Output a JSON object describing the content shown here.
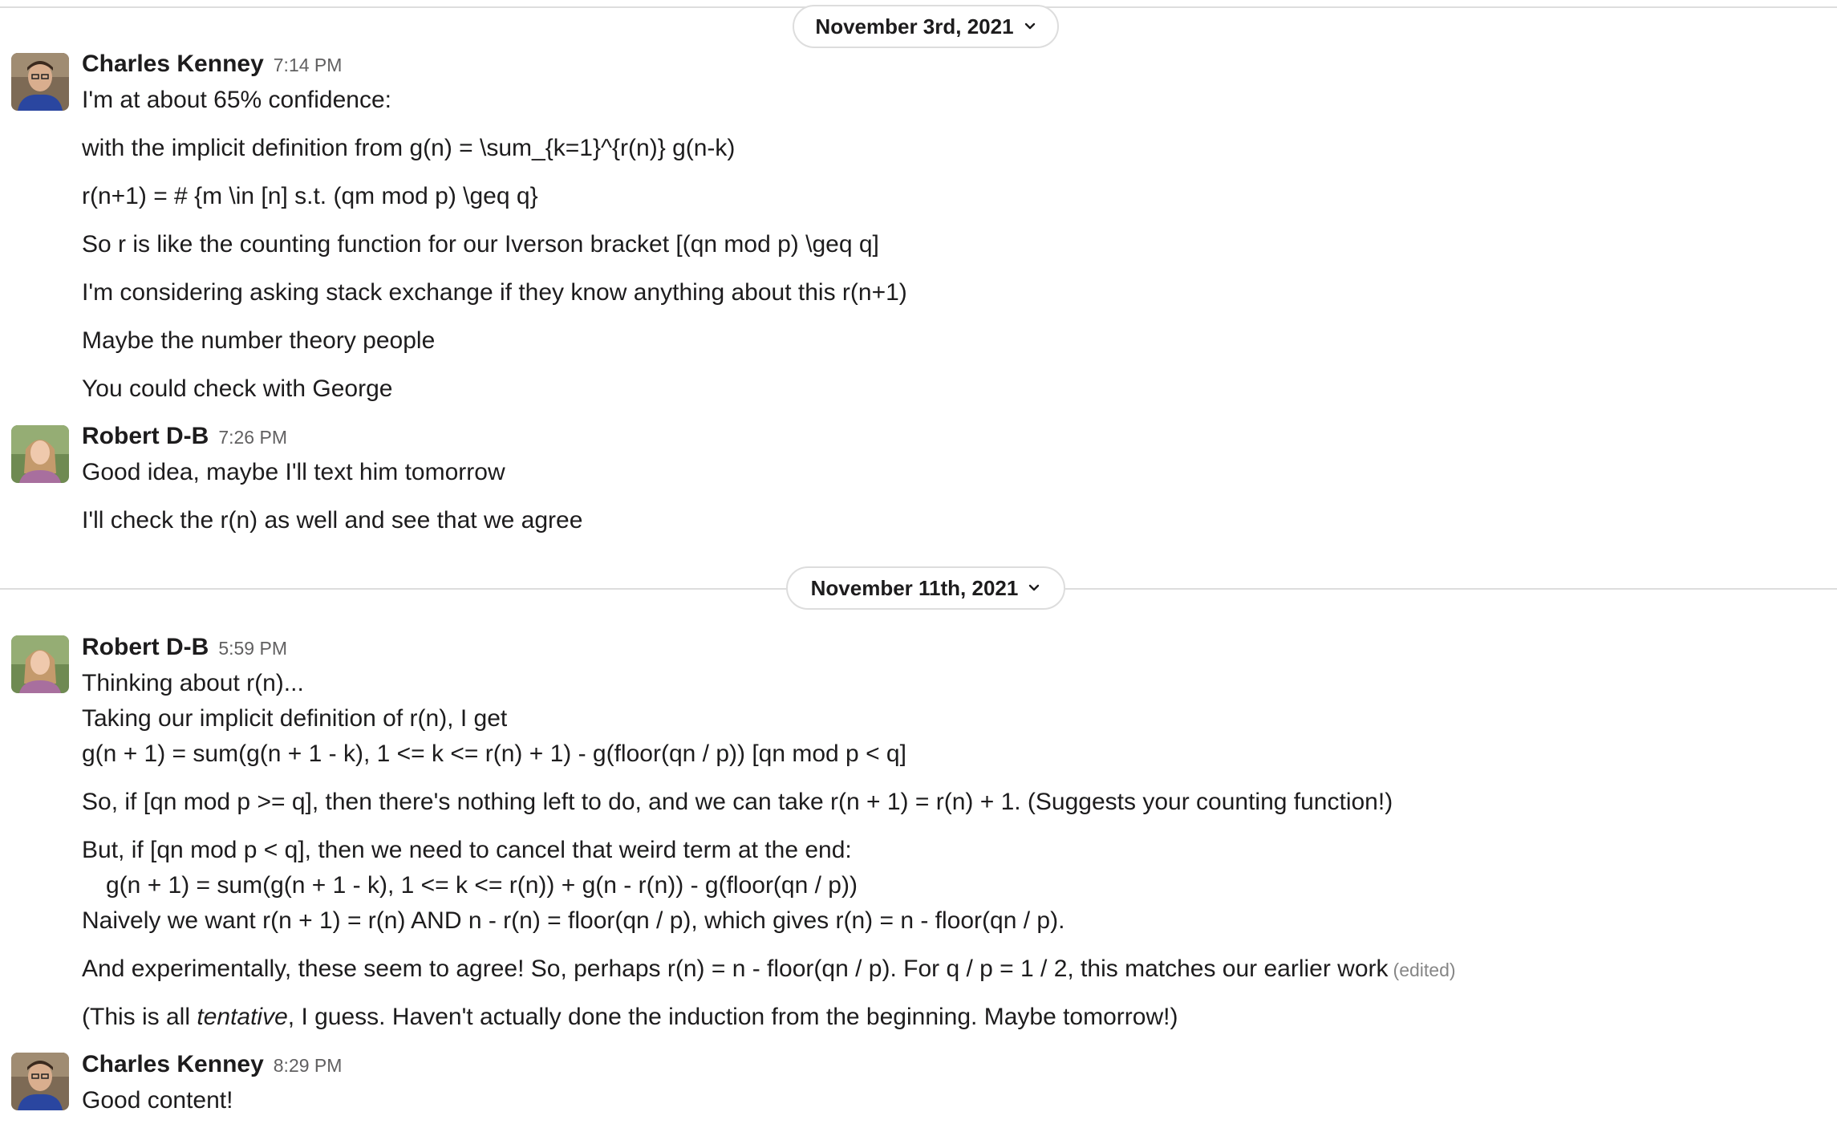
{
  "dates": [
    {
      "label": "November 3rd, 2021"
    },
    {
      "label": "November 11th, 2021"
    }
  ],
  "messages": [
    {
      "author": "Charles Kenney",
      "time": "7:14 PM",
      "lines": [
        "I'm at about 65% confidence:",
        "with the implicit definition from g(n) = \\sum_{k=1}^{r(n)} g(n-k)",
        "r(n+1) = # {m \\in [n]  s.t.  (qm mod p) \\geq q}",
        "So r is like the counting function for our Iverson bracket [(qn mod p) \\geq q]",
        "I'm considering asking stack exchange if they know anything about this r(n+1)",
        "Maybe the number theory people",
        "You could check with George"
      ]
    },
    {
      "author": "Robert D-B",
      "time": "7:26 PM",
      "lines": [
        "Good idea, maybe I'll text him tomorrow",
        "I'll check the r(n) as well and see that we agree"
      ]
    },
    {
      "author": "Robert D-B",
      "time": "5:59 PM",
      "lines": [
        "Thinking about r(n)...",
        "Taking our implicit definition of r(n), I get",
        "g(n + 1) = sum(g(n + 1 - k), 1 <= k <= r(n) + 1) - g(floor(qn / p)) [qn mod p < q]",
        "So, if [qn mod p >= q], then there's nothing left to do, and we can take r(n + 1) = r(n) + 1. (Suggests your counting function!)",
        "But, if [qn mod p < q], then we need to cancel that weird term at the end:",
        "g(n + 1) = sum(g(n + 1 - k), 1 <= k <= r(n)) + g(n - r(n)) - g(floor(qn / p))",
        "Naively we want r(n + 1) = r(n) AND n - r(n) = floor(qn / p), which gives r(n) = n - floor(qn / p).",
        "And experimentally, these seem to agree! So, perhaps r(n) = n - floor(qn / p). For q / p = 1 / 2, this matches our earlier work",
        "(This is all ",
        "tentative",
        ", I guess. Haven't actually done the induction from the beginning. Maybe tomorrow!)"
      ],
      "edited_label": "(edited)"
    },
    {
      "author": "Charles Kenney",
      "time": "8:29 PM",
      "lines": [
        "Good content!"
      ]
    }
  ]
}
